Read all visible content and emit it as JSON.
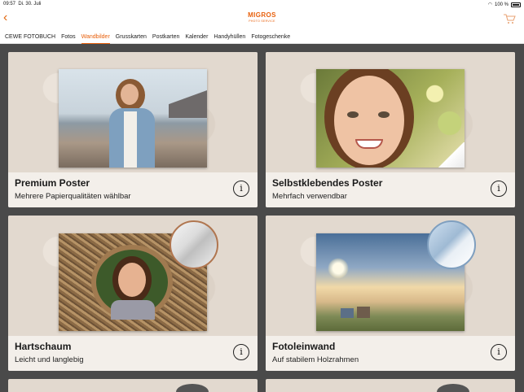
{
  "status": {
    "time": "09:57",
    "date": "Di. 30. Juli",
    "battery": "100 %"
  },
  "header": {
    "brand": "MIGROS",
    "sub": "PHOTO SERVICE"
  },
  "tabs": [
    {
      "label": "CEWE FOTOBUCH",
      "active": false
    },
    {
      "label": "Fotos",
      "active": false
    },
    {
      "label": "Wandbilder",
      "active": true
    },
    {
      "label": "Grusskarten",
      "active": false
    },
    {
      "label": "Postkarten",
      "active": false
    },
    {
      "label": "Kalender",
      "active": false
    },
    {
      "label": "Handyhüllen",
      "active": false
    },
    {
      "label": "Fotogeschenke",
      "active": false
    }
  ],
  "cards": [
    {
      "title": "Premium Poster",
      "subtitle": "Mehrere Papierqualitäten wählbar",
      "info": "i"
    },
    {
      "title": "Selbstklebendes Poster",
      "subtitle": "Mehrfach verwendbar",
      "info": "i"
    },
    {
      "title": "Hartschaum",
      "subtitle": "Leicht und langlebig",
      "info": "i"
    },
    {
      "title": "Fotoleinwand",
      "subtitle": "Auf stabilem Holzrahmen",
      "info": "i"
    }
  ],
  "accent": "#e8600c"
}
